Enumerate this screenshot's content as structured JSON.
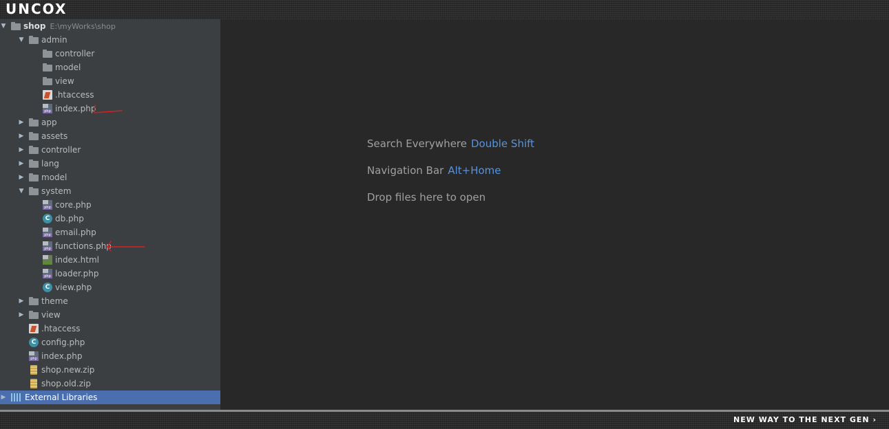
{
  "header": {
    "logo": "UNCOX"
  },
  "footer": {
    "slogan": "NEW WAY TO THE NEXT GEN ›"
  },
  "project": {
    "root": {
      "name": "shop",
      "path": "E:\\myWorks\\shop"
    },
    "items": [
      {
        "label": "admin",
        "icon": "folder-icon",
        "level": 1,
        "arrow": "expanded"
      },
      {
        "label": "controller",
        "icon": "folder-icon",
        "level": 2,
        "arrow": "none"
      },
      {
        "label": "model",
        "icon": "folder-icon",
        "level": 2,
        "arrow": "none"
      },
      {
        "label": "view",
        "icon": "folder-icon",
        "level": 2,
        "arrow": "none"
      },
      {
        "label": ".htaccess",
        "icon": "htaccess-file-icon",
        "level": 2,
        "arrow": "none"
      },
      {
        "label": "index.php",
        "icon": "php-file-icon",
        "level": 2,
        "arrow": "none"
      },
      {
        "label": "app",
        "icon": "folder-icon",
        "level": 1,
        "arrow": "collapsed"
      },
      {
        "label": "assets",
        "icon": "folder-icon",
        "level": 1,
        "arrow": "collapsed"
      },
      {
        "label": "controller",
        "icon": "folder-icon",
        "level": 1,
        "arrow": "collapsed"
      },
      {
        "label": "lang",
        "icon": "folder-icon",
        "level": 1,
        "arrow": "collapsed"
      },
      {
        "label": "model",
        "icon": "folder-icon",
        "level": 1,
        "arrow": "collapsed"
      },
      {
        "label": "system",
        "icon": "folder-icon",
        "level": 1,
        "arrow": "expanded"
      },
      {
        "label": "core.php",
        "icon": "php-file-icon",
        "level": 2,
        "arrow": "none"
      },
      {
        "label": "db.php",
        "icon": "php-class-icon",
        "level": 2,
        "arrow": "none"
      },
      {
        "label": "email.php",
        "icon": "php-file-icon",
        "level": 2,
        "arrow": "none"
      },
      {
        "label": "functions.php",
        "icon": "php-file-icon",
        "level": 2,
        "arrow": "none"
      },
      {
        "label": "index.html",
        "icon": "html-file-icon",
        "level": 2,
        "arrow": "none"
      },
      {
        "label": "loader.php",
        "icon": "php-file-icon",
        "level": 2,
        "arrow": "none"
      },
      {
        "label": "view.php",
        "icon": "php-class-icon",
        "level": 2,
        "arrow": "none"
      },
      {
        "label": "theme",
        "icon": "folder-icon",
        "level": 1,
        "arrow": "collapsed"
      },
      {
        "label": "view",
        "icon": "folder-icon",
        "level": 1,
        "arrow": "collapsed"
      },
      {
        "label": ".htaccess",
        "icon": "htaccess-file-icon",
        "level": 1,
        "arrow": "none"
      },
      {
        "label": "config.php",
        "icon": "php-class-icon",
        "level": 1,
        "arrow": "none"
      },
      {
        "label": "index.php",
        "icon": "php-file-icon",
        "level": 1,
        "arrow": "none"
      },
      {
        "label": "shop.new.zip",
        "icon": "zip-file-icon",
        "level": 1,
        "arrow": "none"
      },
      {
        "label": "shop.old.zip",
        "icon": "zip-file-icon",
        "level": 1,
        "arrow": "none"
      }
    ],
    "external": {
      "label": "External Libraries",
      "icon": "libraries-icon"
    }
  },
  "editor": {
    "hints": [
      {
        "text": "Search Everywhere",
        "key": "Double Shift"
      },
      {
        "text": "Navigation Bar",
        "key": "Alt+Home"
      },
      {
        "text": "Drop files here to open",
        "key": ""
      }
    ]
  },
  "colors": {
    "tree_bg": "#3c3f41",
    "editor_bg": "#282828",
    "selection": "#4b6eaf",
    "shortcut": "#5893dc",
    "annotation": "#d42020"
  }
}
